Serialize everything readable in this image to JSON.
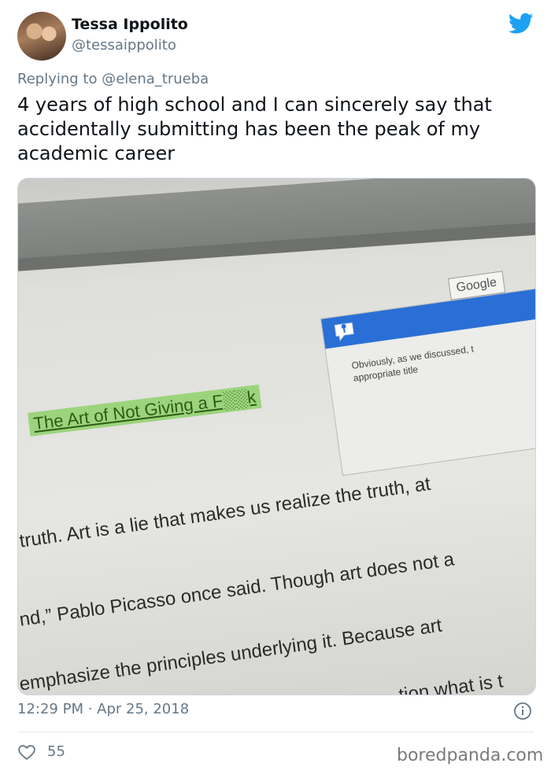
{
  "author": {
    "name": "Tessa Ippolito",
    "handle": "@tessaippolito"
  },
  "reply": {
    "prefix": "Replying to",
    "mention": "@elena_trueba"
  },
  "tweet": {
    "text": "4 years of high school and I can sincerely say that accidentally submitting has been the peak of my academic career"
  },
  "photo": {
    "google_label": "Google",
    "comment_line1": "Obviously, as we discussed, t",
    "comment_line2": "appropriate title",
    "highlighted_title": "The Art of Not Giving a F░░k",
    "doc_lines": [
      "truth. Art is a lie that makes us realize the truth, at",
      "nd,” Pablo Picasso once said. Though art does not a",
      "emphasize the principles underlying it. Because art",
      "tion what is t"
    ]
  },
  "meta": {
    "timestamp": "12:29 PM · Apr 25, 2018",
    "likes": "55"
  },
  "watermark": "boredpanda.com",
  "colors": {
    "twitter_blue": "#1da1f2",
    "secondary_text": "#657786",
    "highlight_green": "#9bd47c",
    "comment_header_blue": "#2a6fd6"
  },
  "icons": {
    "bird": "twitter-bird-icon",
    "info": "info-icon",
    "heart": "heart-icon"
  }
}
